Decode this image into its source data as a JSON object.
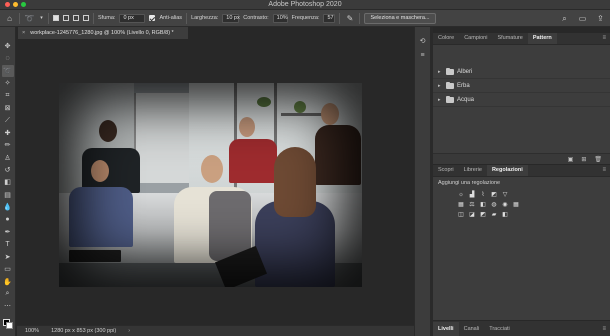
{
  "app": {
    "title": "Adobe Photoshop 2020"
  },
  "options_bar": {
    "sfuma_label": "Sfuma:",
    "sfuma_value": "0 px",
    "antialias_label": "Anti-alias",
    "larghezza_label": "Larghezza:",
    "larghezza_value": "10 px",
    "contrasto_label": "Contrasto:",
    "contrasto_value": "10%",
    "frequenza_label": "Frequenza:",
    "frequenza_value": "57",
    "mask_button": "Seleziona e maschera..."
  },
  "document": {
    "tab_label": "workplace-1245776_1280.jpg @ 100% (Livello 0, RGB/8) *"
  },
  "status": {
    "zoom": "100%",
    "info": "1280 px x 853 px (300 ppi)"
  },
  "top_panel": {
    "tabs": [
      "Colore",
      "Campioni",
      "Sfumature",
      "Pattern"
    ],
    "folders": [
      "Alberi",
      "Erba",
      "Acqua"
    ]
  },
  "mid_panel": {
    "tabs": [
      "Scopri",
      "Librerie",
      "Regolazioni"
    ],
    "adjust_title": "Aggiungi una regolazione"
  },
  "bottom_panel": {
    "tabs": [
      "Livelli",
      "Canali",
      "Tracciati"
    ]
  },
  "colors": {
    "accent": "#2680eb",
    "close": "#ff5f57",
    "minimize": "#febc2e",
    "zoom": "#28c840"
  }
}
